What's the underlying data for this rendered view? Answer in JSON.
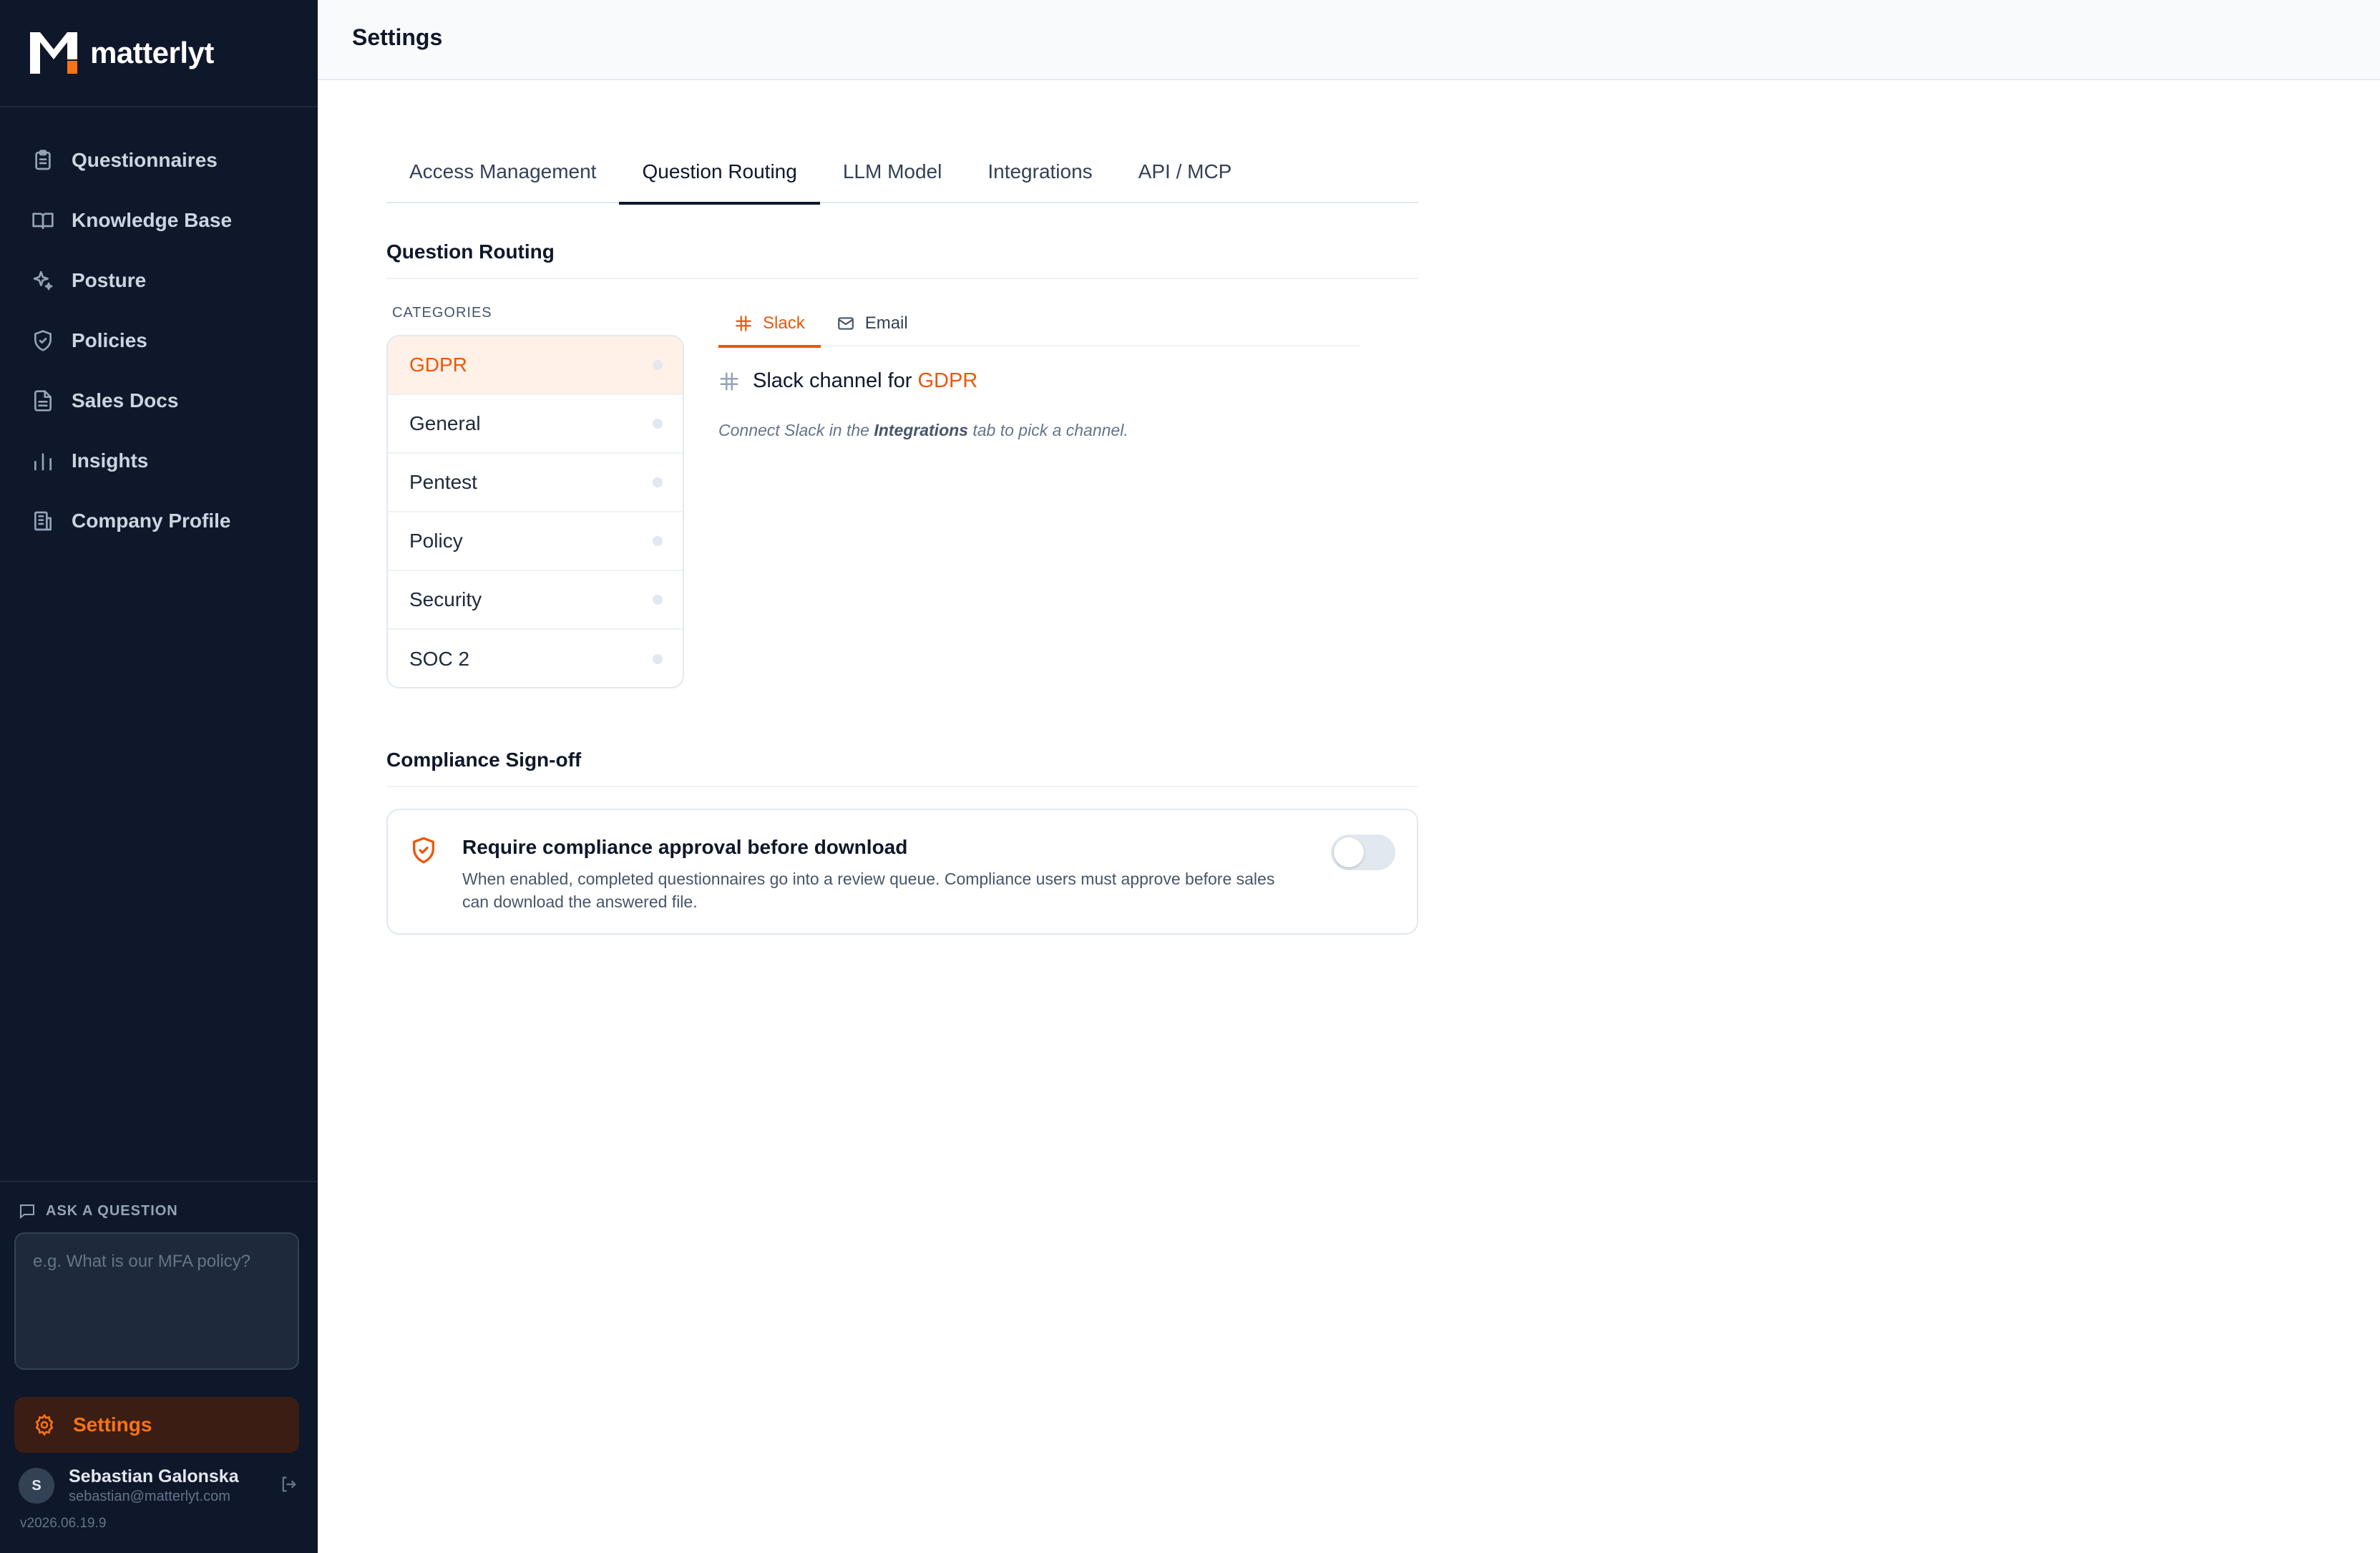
{
  "app": {
    "name": "matterlyt",
    "version": "v2026.06.19.9"
  },
  "colors": {
    "sidebar_bg": "#0f172a",
    "accent": "#ea580c",
    "active_settings_bg": "#3b1d14"
  },
  "sidebar": {
    "items": [
      {
        "label": "Questionnaires",
        "icon": "clipboard-icon"
      },
      {
        "label": "Knowledge Base",
        "icon": "book-icon"
      },
      {
        "label": "Posture",
        "icon": "sparkle-icon"
      },
      {
        "label": "Policies",
        "icon": "shield-icon"
      },
      {
        "label": "Sales Docs",
        "icon": "document-icon"
      },
      {
        "label": "Insights",
        "icon": "bar-chart-icon"
      },
      {
        "label": "Company Profile",
        "icon": "building-icon"
      }
    ],
    "ask": {
      "label": "ASK A QUESTION",
      "placeholder": "e.g. What is our MFA policy?"
    },
    "settings_label": "Settings",
    "user": {
      "initial": "S",
      "name": "Sebastian Galonska",
      "email": "sebastian@matterlyt.com"
    }
  },
  "header": {
    "title": "Settings"
  },
  "tabs": [
    {
      "label": "Access Management",
      "active": false
    },
    {
      "label": "Question Routing",
      "active": true
    },
    {
      "label": "LLM Model",
      "active": false
    },
    {
      "label": "Integrations",
      "active": false
    },
    {
      "label": "API / MCP",
      "active": false
    }
  ],
  "routing": {
    "title": "Question Routing",
    "categories_label": "CATEGORIES",
    "categories": [
      "GDPR",
      "General",
      "Pentest",
      "Policy",
      "Security",
      "SOC 2"
    ],
    "selected_category": "GDPR",
    "channel_tabs": [
      {
        "label": "Slack",
        "icon": "slack-icon",
        "active": true
      },
      {
        "label": "Email",
        "icon": "mail-icon",
        "active": false
      }
    ],
    "slack_heading_prefix": "Slack channel for",
    "slack_heading_category": "GDPR",
    "hint_before": "Connect Slack in the ",
    "hint_bold": "Integrations",
    "hint_after": " tab to pick a channel."
  },
  "signoff": {
    "title": "Compliance Sign-off",
    "card_title": "Require compliance approval before download",
    "card_desc": "When enabled, completed questionnaires go into a review queue. Compliance users must approve before sales can download the answered file.",
    "enabled": false
  }
}
